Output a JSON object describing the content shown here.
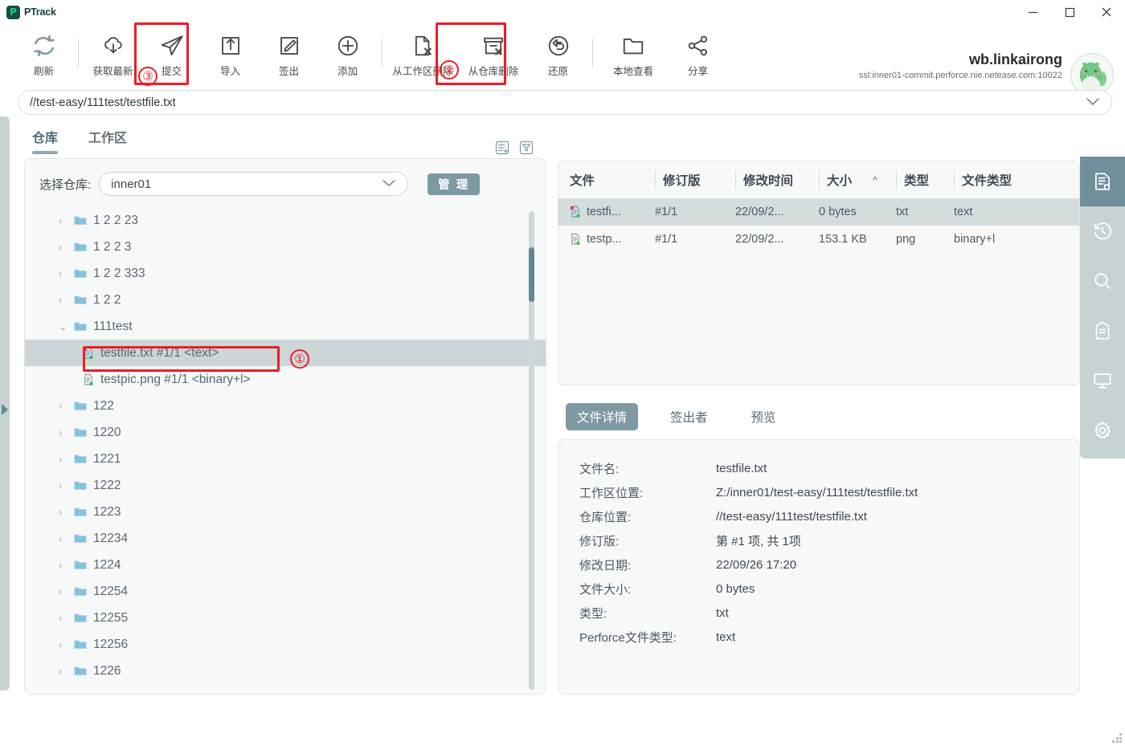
{
  "titlebar": {
    "app_name": "PTrack",
    "logo_letter": "P",
    "minimize": "minimize-button",
    "maximize": "maximize-button",
    "close": "close-button"
  },
  "toolbar": {
    "buttons": [
      {
        "label": "刷新",
        "icon": "refresh-icon"
      },
      {
        "label": "获取最新",
        "icon": "cloud-download-icon"
      },
      {
        "label": "提交",
        "icon": "send-paperplane-icon",
        "annotation": "③"
      },
      {
        "label": "导入",
        "icon": "import-box-icon"
      },
      {
        "label": "签出",
        "icon": "checkout-edit-icon"
      },
      {
        "label": "添加",
        "icon": "plus-circle-icon"
      },
      {
        "label": "从工作区删除",
        "icon": "file-delete-icon"
      },
      {
        "label": "从仓库删除",
        "icon": "archive-delete-icon",
        "annotation": "②"
      },
      {
        "label": "还原",
        "icon": "revert-undo-icon"
      },
      {
        "label": "本地查看",
        "icon": "folder-open-icon"
      },
      {
        "label": "分享",
        "icon": "share-nodes-icon"
      }
    ],
    "account_name": "wb.linkairong",
    "account_host": "ssl:inner01-commit.perforce.nie.netease.com:10022"
  },
  "pathbar": {
    "value": "//test-easy/111test/testfile.txt",
    "caret": "⌄"
  },
  "tabs": [
    {
      "label": "仓库",
      "active": true
    },
    {
      "label": "工作区",
      "active": false
    }
  ],
  "left_panel": {
    "repo_label": "选择仓库:",
    "repo_value": "inner01",
    "manage_button": "管 理",
    "tree": [
      {
        "name": "1 2 2 23",
        "type": "folder",
        "expanded": false,
        "indent": 0
      },
      {
        "name": "1 2 2 3",
        "type": "folder",
        "expanded": false,
        "indent": 0
      },
      {
        "name": "1 2 2 333",
        "type": "folder",
        "expanded": false,
        "indent": 0
      },
      {
        "name": "1 2 2",
        "type": "folder",
        "expanded": false,
        "indent": 0
      },
      {
        "name": "111test",
        "type": "folder",
        "expanded": true,
        "indent": 0
      },
      {
        "name": "testfile.txt  #1/1 <text>",
        "type": "file-modified",
        "indent": 1,
        "selected": true,
        "annotation": "①"
      },
      {
        "name": "testpic.png  #1/1 <binary+l>",
        "type": "file",
        "indent": 1,
        "selected": false
      },
      {
        "name": "122",
        "type": "folder",
        "expanded": false,
        "indent": 0
      },
      {
        "name": "1220",
        "type": "folder",
        "expanded": false,
        "indent": 0
      },
      {
        "name": "1221",
        "type": "folder",
        "expanded": false,
        "indent": 0
      },
      {
        "name": "1222",
        "type": "folder",
        "expanded": false,
        "indent": 0
      },
      {
        "name": "1223",
        "type": "folder",
        "expanded": false,
        "indent": 0
      },
      {
        "name": "12234",
        "type": "folder",
        "expanded": false,
        "indent": 0
      },
      {
        "name": "1224",
        "type": "folder",
        "expanded": false,
        "indent": 0
      },
      {
        "name": "12254",
        "type": "folder",
        "expanded": false,
        "indent": 0
      },
      {
        "name": "12255",
        "type": "folder",
        "expanded": false,
        "indent": 0
      },
      {
        "name": "12256",
        "type": "folder",
        "expanded": false,
        "indent": 0
      },
      {
        "name": "1226",
        "type": "folder",
        "expanded": false,
        "indent": 0
      }
    ]
  },
  "file_list": {
    "columns": [
      "文件",
      "修订版",
      "修改时间",
      "大小",
      "类型",
      "文件类型"
    ],
    "sort_caret": "^",
    "rows": [
      {
        "file": "testfi...",
        "rev": "#1/1",
        "time": "22/09/2...",
        "size": "0 bytes",
        "type": "txt",
        "ftype": "text",
        "selected": true,
        "modified": true
      },
      {
        "file": "testp...",
        "rev": "#1/1",
        "time": "22/09/2...",
        "size": "153.1 KB",
        "type": "png",
        "ftype": "binary+l",
        "selected": false,
        "modified": false
      }
    ]
  },
  "detail_tabs": [
    {
      "label": "文件详情",
      "active": true
    },
    {
      "label": "签出者",
      "active": false
    },
    {
      "label": "预览",
      "active": false
    }
  ],
  "detail": {
    "rows": [
      {
        "key": "文件名:",
        "value": "testfile.txt"
      },
      {
        "key": "工作区位置:",
        "value": "Z:/inner01/test-easy/111test/testfile.txt"
      },
      {
        "key": "仓库位置:",
        "value": "//test-easy/111test/testfile.txt"
      },
      {
        "key": "修订版:",
        "value": "第 #1 项, 共 1项"
      },
      {
        "key": "修改日期:",
        "value": "22/09/26 17:20"
      },
      {
        "key": "文件大小:",
        "value": "0 bytes"
      },
      {
        "key": "类型:",
        "value": "txt"
      },
      {
        "key": "Perforce文件类型:",
        "value": "text"
      }
    ]
  },
  "right_rail": [
    {
      "icon": "document-details-icon",
      "active": true
    },
    {
      "icon": "history-clock-icon",
      "active": false
    },
    {
      "icon": "search-icon",
      "active": false
    },
    {
      "icon": "archive-box-icon",
      "active": false
    },
    {
      "icon": "monitor-icon",
      "active": false
    },
    {
      "icon": "gear-settings-icon",
      "active": false
    }
  ],
  "colors": {
    "accent": "#7d99a2",
    "rail": "#c7d2d4",
    "annotation_red": "#ee1c25",
    "brand_dark": "#124f4a",
    "brand_green": "#3bc37a"
  }
}
